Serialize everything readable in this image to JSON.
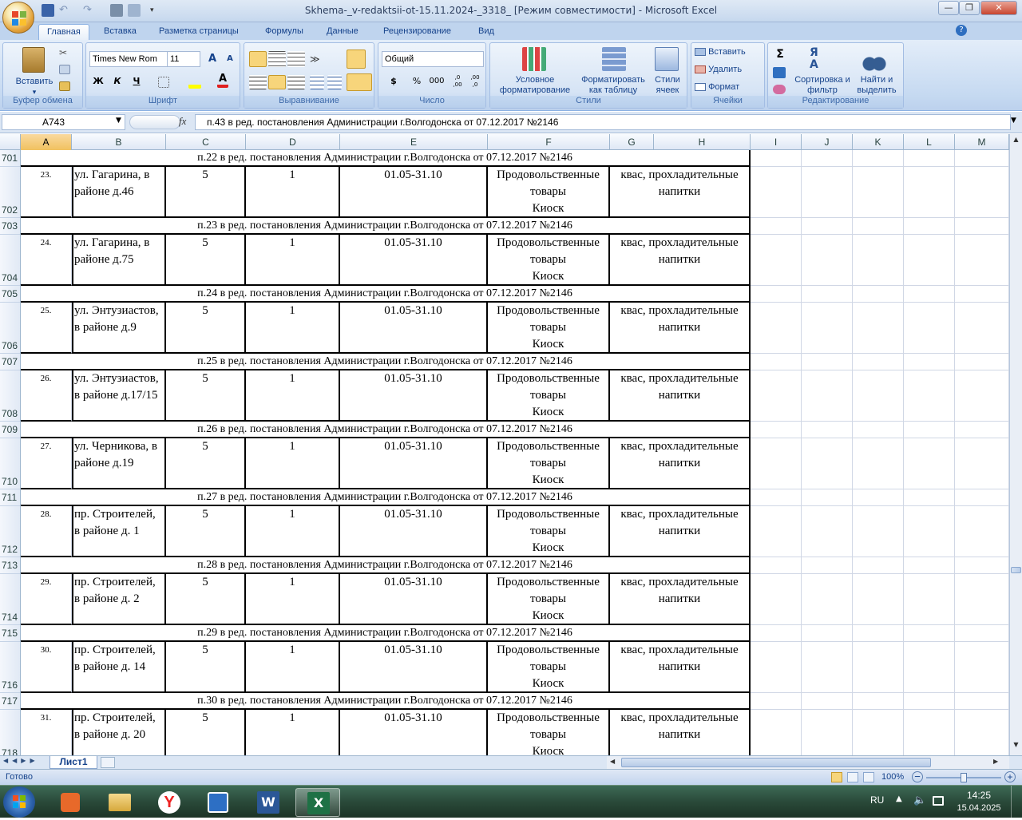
{
  "window": {
    "title": "Skhema-_v-redaktsii-ot-15.11.2024-_3318_  [Режим совместимости] - Microsoft Excel",
    "minimize": "—",
    "restore": "❐",
    "close": "✕"
  },
  "ribbon_tabs": [
    "Главная",
    "Вставка",
    "Разметка страницы",
    "Формулы",
    "Данные",
    "Рецензирование",
    "Вид"
  ],
  "ribbon": {
    "clipboard": {
      "label": "Буфер обмена",
      "paste": "Вставить"
    },
    "font": {
      "label": "Шрифт",
      "font_name": "Times New Rom",
      "font_size": "11",
      "grow": "A",
      "shrink": "A",
      "bold": "Ж",
      "italic": "К",
      "underline": "Ч"
    },
    "alignment": {
      "label": "Выравнивание"
    },
    "number": {
      "label": "Число",
      "format": "Общий",
      "currency": "$",
      "percent": "%",
      "thousands": "000",
      "inc_dec": ",0 ,00",
      "dec_dec": ",00 ,0"
    },
    "styles": {
      "label": "Стили",
      "conditional": "Условное форматирование",
      "as_table": "Форматировать как таблицу",
      "cell_styles": "Стили ячеек"
    },
    "cells": {
      "label": "Ячейки",
      "insert": "Вставить",
      "delete": "Удалить",
      "format": "Формат"
    },
    "editing": {
      "label": "Редактирование",
      "sum": "Σ",
      "sort": "Сортировка и фильтр",
      "find": "Найти и выделить"
    }
  },
  "formula_bar": {
    "name_box": "A743",
    "fx": "fx",
    "formula": "п.43 в ред. постановления Администрации г.Волгодонска от 07.12.2017 №2146"
  },
  "columns": [
    "A",
    "B",
    "C",
    "D",
    "E",
    "F",
    "G",
    "H",
    "I",
    "J",
    "K",
    "L",
    "M"
  ],
  "rows": [
    {
      "hdr": "701",
      "type": "note",
      "text": "п.22 в ред. постановления Администрации г.Волгодонска от 07.12.2017 №2146"
    },
    {
      "hdr": "702",
      "type": "data",
      "num": "23.",
      "addr1": "ул. Гагарина, в",
      "addr2": "районе д.46",
      "c": "5",
      "d": "1",
      "e": "01.05-31.10",
      "f1": "Продовольственные",
      "f2": "товары",
      "f3": "Киоск",
      "g1": "квас, прохладительные",
      "g2": "напитки"
    },
    {
      "hdr": "703",
      "type": "note",
      "text": "п.23 в ред. постановления Администрации г.Волгодонска от 07.12.2017 №2146"
    },
    {
      "hdr": "704",
      "type": "data",
      "num": "24.",
      "addr1": "ул. Гагарина, в",
      "addr2": "районе д.75",
      "c": "5",
      "d": "1",
      "e": "01.05-31.10",
      "f1": "Продовольственные",
      "f2": "товары",
      "f3": "Киоск",
      "g1": "квас, прохладительные",
      "g2": "напитки"
    },
    {
      "hdr": "705",
      "type": "note",
      "text": "п.24 в ред. постановления Администрации г.Волгодонска от 07.12.2017 №2146"
    },
    {
      "hdr": "706",
      "type": "data",
      "num": "25.",
      "addr1": "ул. Энтузиастов,",
      "addr2": "в районе д.9",
      "c": "5",
      "d": "1",
      "e": "01.05-31.10",
      "f1": "Продовольственные",
      "f2": "товары",
      "f3": "Киоск",
      "g1": "квас, прохладительные",
      "g2": "напитки"
    },
    {
      "hdr": "707",
      "type": "note",
      "text": "п.25 в ред. постановления Администрации г.Волгодонска от 07.12.2017 №2146"
    },
    {
      "hdr": "708",
      "type": "data",
      "num": "26.",
      "addr1": "ул. Энтузиастов,",
      "addr2": "в районе д.17/15",
      "c": "5",
      "d": "1",
      "e": "01.05-31.10",
      "f1": "Продовольственные",
      "f2": "товары",
      "f3": "Киоск",
      "g1": "квас, прохладительные",
      "g2": "напитки"
    },
    {
      "hdr": "709",
      "type": "note",
      "text": "п.26 в ред. постановления Администрации г.Волгодонска от 07.12.2017 №2146"
    },
    {
      "hdr": "710",
      "type": "data",
      "num": "27.",
      "addr1": "ул. Черникова, в",
      "addr2": "районе д.19",
      "c": "5",
      "d": "1",
      "e": "01.05-31.10",
      "f1": "Продовольственные",
      "f2": "товары",
      "f3": "Киоск",
      "g1": "квас, прохладительные",
      "g2": "напитки"
    },
    {
      "hdr": "711",
      "type": "note",
      "text": "п.27 в ред. постановления Администрации г.Волгодонска от 07.12.2017 №2146"
    },
    {
      "hdr": "712",
      "type": "data",
      "num": "28.",
      "addr1": "пр. Строителей,",
      "addr2": "в районе д. 1",
      "c": "5",
      "d": "1",
      "e": "01.05-31.10",
      "f1": "Продовольственные",
      "f2": "товары",
      "f3": "Киоск",
      "g1": "квас, прохладительные",
      "g2": "напитки"
    },
    {
      "hdr": "713",
      "type": "note",
      "text": "п.28 в ред. постановления Администрации г.Волгодонска от 07.12.2017 №2146"
    },
    {
      "hdr": "714",
      "type": "data",
      "num": "29.",
      "addr1": "пр. Строителей,",
      "addr2": "в районе д. 2",
      "c": "5",
      "d": "1",
      "e": "01.05-31.10",
      "f1": "Продовольственные",
      "f2": "товары",
      "f3": "Киоск",
      "g1": "квас, прохладительные",
      "g2": "напитки"
    },
    {
      "hdr": "715",
      "type": "note",
      "text": "п.29 в ред. постановления Администрации г.Волгодонска от 07.12.2017 №2146"
    },
    {
      "hdr": "716",
      "type": "data",
      "num": "30.",
      "addr1": "пр. Строителей,",
      "addr2": "в районе д. 14",
      "c": "5",
      "d": "1",
      "e": "01.05-31.10",
      "f1": "Продовольственные",
      "f2": "товары",
      "f3": "Киоск",
      "g1": "квас, прохладительные",
      "g2": "напитки"
    },
    {
      "hdr": "717",
      "type": "note",
      "text": "п.30 в ред. постановления Администрации г.Волгодонска от 07.12.2017 №2146"
    },
    {
      "hdr": "718",
      "type": "data",
      "num": "31.",
      "addr1": "пр. Строителей,",
      "addr2": "в районе д. 20",
      "c": "5",
      "d": "1",
      "e": "01.05-31.10",
      "f1": "Продовольственные",
      "f2": "товары",
      "f3": "Киоск",
      "g1": "квас, прохладительные",
      "g2": "напитки"
    }
  ],
  "sheet_tab": "Лист1",
  "status": {
    "ready": "Готово",
    "zoom": "100%"
  },
  "taskbar": {
    "lang": "RU",
    "time": "14:25",
    "date": "15.04.2025"
  }
}
